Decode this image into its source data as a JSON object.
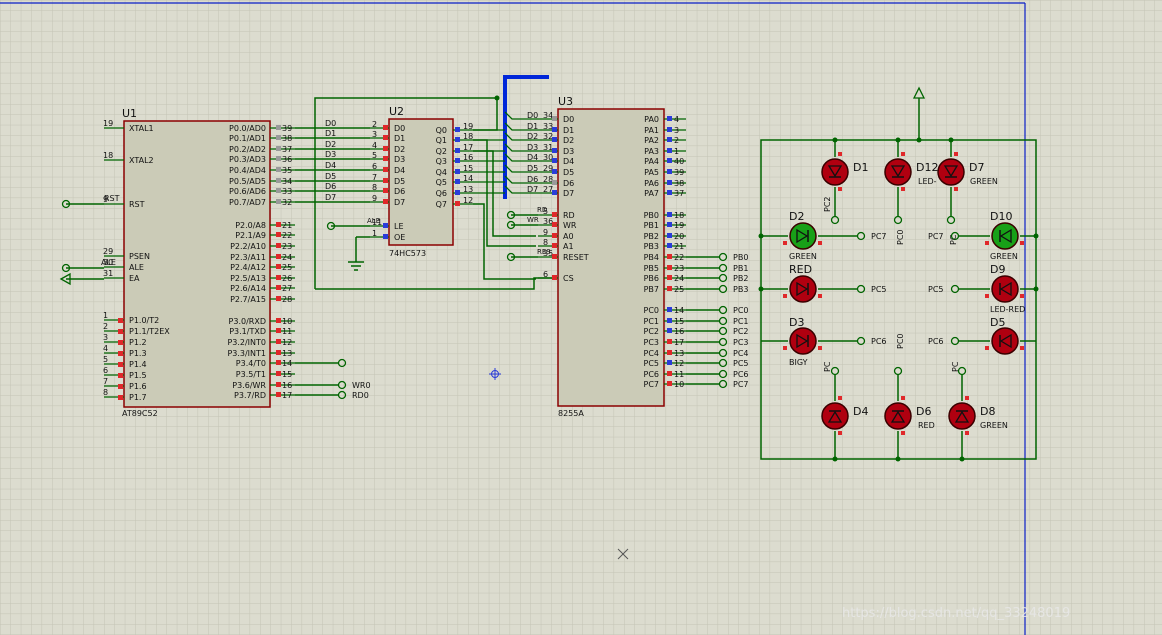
{
  "u1": {
    "ref": "U1",
    "part": "AT89C52",
    "pins_left": [
      {
        "num": "19",
        "name": "XTAL1"
      },
      {
        "num": "18",
        "name": "XTAL2"
      },
      {
        "num": "9",
        "name": "RST"
      },
      {
        "num": "29",
        "name": "PSEN"
      },
      {
        "num": "30",
        "name": "ALE"
      },
      {
        "num": "31",
        "name": "EA"
      },
      {
        "num": "1",
        "name": "P1.0/T2"
      },
      {
        "num": "2",
        "name": "P1.1/T2EX"
      },
      {
        "num": "3",
        "name": "P1.2"
      },
      {
        "num": "4",
        "name": "P1.3"
      },
      {
        "num": "5",
        "name": "P1.4"
      },
      {
        "num": "6",
        "name": "P1.5"
      },
      {
        "num": "7",
        "name": "P1.6"
      },
      {
        "num": "8",
        "name": "P1.7"
      }
    ],
    "pins_right": [
      {
        "num": "39",
        "name": "P0.0/AD0"
      },
      {
        "num": "38",
        "name": "P0.1/AD1"
      },
      {
        "num": "37",
        "name": "P0.2/AD2"
      },
      {
        "num": "36",
        "name": "P0.3/AD3"
      },
      {
        "num": "35",
        "name": "P0.4/AD4"
      },
      {
        "num": "34",
        "name": "P0.5/AD5"
      },
      {
        "num": "33",
        "name": "P0.6/AD6"
      },
      {
        "num": "32",
        "name": "P0.7/AD7"
      },
      {
        "num": "21",
        "name": "P2.0/A8"
      },
      {
        "num": "22",
        "name": "P2.1/A9"
      },
      {
        "num": "23",
        "name": "P2.2/A10"
      },
      {
        "num": "24",
        "name": "P2.3/A11"
      },
      {
        "num": "25",
        "name": "P2.4/A12"
      },
      {
        "num": "26",
        "name": "P2.5/A13"
      },
      {
        "num": "27",
        "name": "P2.6/A14"
      },
      {
        "num": "28",
        "name": "P2.7/A15"
      },
      {
        "num": "10",
        "name": "P3.0/RXD"
      },
      {
        "num": "11",
        "name": "P3.1/TXD"
      },
      {
        "num": "12",
        "name": "P3.2/INT0"
      },
      {
        "num": "13",
        "name": "P3.3/INT1"
      },
      {
        "num": "14",
        "name": "P3.4/T0"
      },
      {
        "num": "15",
        "name": "P3.5/T1"
      },
      {
        "num": "16",
        "name": "P3.6/WR"
      },
      {
        "num": "17",
        "name": "P3.7/RD"
      }
    ],
    "net_labels": [
      "RST",
      "ALE",
      "EA"
    ]
  },
  "u2": {
    "ref": "U2",
    "part": "74HC573",
    "pins_left": [
      {
        "num": "2",
        "name": "D0"
      },
      {
        "num": "3",
        "name": "D1"
      },
      {
        "num": "4",
        "name": "D2"
      },
      {
        "num": "5",
        "name": "D3"
      },
      {
        "num": "6",
        "name": "D4"
      },
      {
        "num": "7",
        "name": "D5"
      },
      {
        "num": "8",
        "name": "D6"
      },
      {
        "num": "9",
        "name": "D7"
      },
      {
        "num": "11",
        "name": "LE"
      },
      {
        "num": "1",
        "name": "OE"
      }
    ],
    "pins_right": [
      {
        "num": "19",
        "name": "Q0"
      },
      {
        "num": "18",
        "name": "Q1"
      },
      {
        "num": "17",
        "name": "Q2"
      },
      {
        "num": "16",
        "name": "Q3"
      },
      {
        "num": "15",
        "name": "Q4"
      },
      {
        "num": "14",
        "name": "Q5"
      },
      {
        "num": "13",
        "name": "Q6"
      },
      {
        "num": "12",
        "name": "Q7"
      }
    ],
    "bus_labels": [
      "D0",
      "D1",
      "D2",
      "D3",
      "D4",
      "D5",
      "D6",
      "D7"
    ],
    "ale_label": "ALE"
  },
  "u3": {
    "ref": "U3",
    "part": "8255A",
    "pins_left": [
      {
        "num": "34",
        "name": "D0"
      },
      {
        "num": "33",
        "name": "D1"
      },
      {
        "num": "32",
        "name": "D2"
      },
      {
        "num": "31",
        "name": "D3"
      },
      {
        "num": "30",
        "name": "D4"
      },
      {
        "num": "29",
        "name": "D5"
      },
      {
        "num": "28",
        "name": "D6"
      },
      {
        "num": "27",
        "name": "D7"
      },
      {
        "num": "5",
        "name": "RD"
      },
      {
        "num": "36",
        "name": "WR"
      },
      {
        "num": "9",
        "name": "A0"
      },
      {
        "num": "8",
        "name": "A1"
      },
      {
        "num": "35",
        "name": "RESET"
      },
      {
        "num": "6",
        "name": "CS"
      }
    ],
    "pins_right": [
      {
        "num": "4",
        "name": "PA0"
      },
      {
        "num": "3",
        "name": "PA1"
      },
      {
        "num": "2",
        "name": "PA2"
      },
      {
        "num": "1",
        "name": "PA3"
      },
      {
        "num": "40",
        "name": "PA4"
      },
      {
        "num": "39",
        "name": "PA5"
      },
      {
        "num": "38",
        "name": "PA6"
      },
      {
        "num": "37",
        "name": "PA7"
      },
      {
        "num": "18",
        "name": "PB0"
      },
      {
        "num": "19",
        "name": "PB1"
      },
      {
        "num": "20",
        "name": "PB2"
      },
      {
        "num": "21",
        "name": "PB3"
      },
      {
        "num": "22",
        "name": "PB4"
      },
      {
        "num": "23",
        "name": "PB5"
      },
      {
        "num": "24",
        "name": "PB6"
      },
      {
        "num": "25",
        "name": "PB7"
      },
      {
        "num": "14",
        "name": "PC0"
      },
      {
        "num": "15",
        "name": "PC1"
      },
      {
        "num": "16",
        "name": "PC2"
      },
      {
        "num": "17",
        "name": "PC3"
      },
      {
        "num": "13",
        "name": "PC4"
      },
      {
        "num": "12",
        "name": "PC5"
      },
      {
        "num": "11",
        "name": "PC6"
      },
      {
        "num": "10",
        "name": "PC7"
      }
    ],
    "bus_labels": [
      "D0",
      "D1",
      "D2",
      "D3",
      "D4",
      "D5",
      "D6",
      "D7"
    ],
    "ctrl_labels": [
      "RD",
      "WR",
      "RES"
    ],
    "pb_net": [
      "PB0",
      "PB1",
      "PB2",
      "PB3"
    ],
    "pc_net": [
      "PC0",
      "PC1",
      "PC2",
      "PC3",
      "PC4",
      "PC5",
      "PC6",
      "PC7"
    ]
  },
  "p3_labels": [
    "WR0",
    "RD0"
  ],
  "leds": [
    {
      "ref": "D1",
      "value": "",
      "color": "red"
    },
    {
      "ref": "D12",
      "value": "LED-",
      "color": "red"
    },
    {
      "ref": "D7",
      "value": "GREEN",
      "color": "red"
    },
    {
      "ref": "D2",
      "value": "GREEN",
      "color": "green"
    },
    {
      "ref": "D10",
      "value": "GREEN",
      "color": "green"
    },
    {
      "ref": "RED",
      "value": "",
      "color": "red"
    },
    {
      "ref": "D9",
      "value": "LED-RED",
      "color": "red"
    },
    {
      "ref": "D3",
      "value": "BIGY",
      "color": "red"
    },
    {
      "ref": "D5",
      "value": "",
      "color": "red"
    },
    {
      "ref": "D4",
      "value": "",
      "color": "red"
    },
    {
      "ref": "D6",
      "value": "RED",
      "color": "red"
    },
    {
      "ref": "D8",
      "value": "GREEN",
      "color": "red"
    }
  ],
  "led_nets": {
    "d2_right": "PC7",
    "d10_left": "PC7",
    "red_right": "PC5",
    "d9_left": "PC5",
    "d3_right": "PC6",
    "d5_left": "PC6",
    "vert_top_left": "PC2",
    "vert_top_mid": "PC0",
    "vert_top_right": "PC",
    "vert_bot_left": "PC",
    "vert_bot_mid": "PC0",
    "vert_bot_right": "PC"
  },
  "watermark": "https://blog.csdn.net/qq_33248019",
  "colors": {
    "background": "#dcdccf",
    "grid": "#c7c7b8",
    "wire": "#006400",
    "chip_border": "#8b0000",
    "chip_fill": "#c9c9b4",
    "bus": "#0026d9",
    "pin_red": "#e0282a",
    "pin_blue": "#2a3cd8",
    "led_red": "#b00010",
    "led_green": "#18a018",
    "frame_blue": "#0a1ec8"
  }
}
